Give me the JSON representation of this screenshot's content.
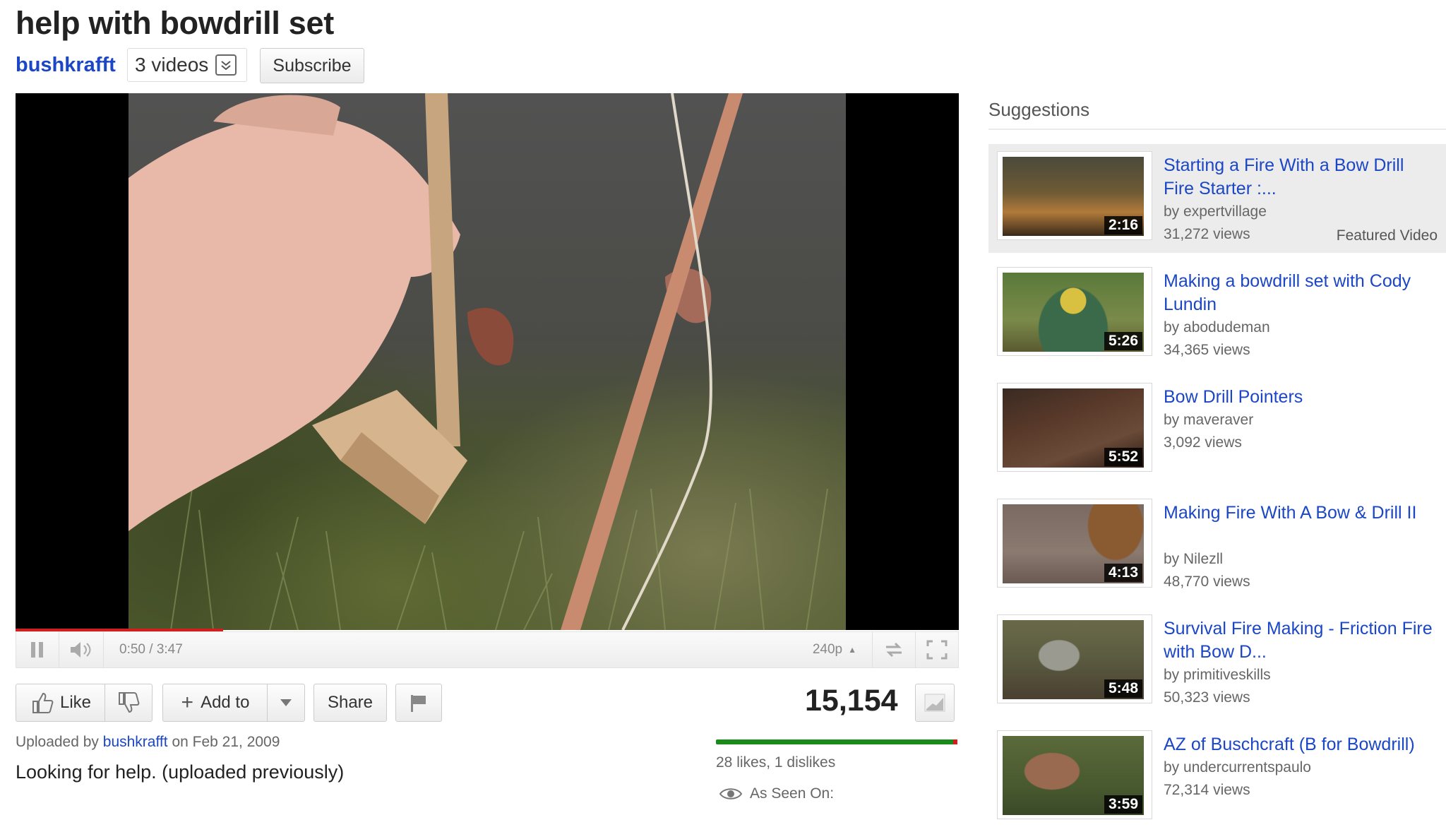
{
  "video": {
    "title": "help with bowdrill set",
    "channel": "bushkrafft",
    "videos_count": "3 videos",
    "subscribe_label": "Subscribe"
  },
  "player": {
    "time": "0:50 / 3:47",
    "quality": "240p",
    "progress_fraction": 0.22
  },
  "actions": {
    "like_label": "Like",
    "add_to_label": "Add to",
    "share_label": "Share",
    "view_count": "15,154"
  },
  "info": {
    "uploaded_prefix": "Uploaded by",
    "uploader": "bushkrafft",
    "date_text": "on Feb 21, 2009",
    "description": "Looking for help. (uploaded previously)",
    "likes_text": "28 likes, 1 dislikes",
    "as_seen_on": "As Seen On:",
    "likes": 28,
    "dislikes": 1
  },
  "sidebar": {
    "heading": "Suggestions",
    "items": [
      {
        "title": "Starting a Fire With a Bow Drill Fire Starter :...",
        "by": "by expertvillage",
        "views": "31,272 views",
        "duration": "2:16",
        "featured_label": "Featured Video"
      },
      {
        "title": "Making a bowdrill set with Cody Lundin",
        "by": "by abodudeman",
        "views": "34,365 views",
        "duration": "5:26"
      },
      {
        "title": "Bow Drill Pointers",
        "by": "by maveraver",
        "views": "3,092 views",
        "duration": "5:52"
      },
      {
        "title": "Making Fire With A Bow & Drill II",
        "by": "by Nilezll",
        "views": "48,770 views",
        "duration": "4:13"
      },
      {
        "title": "Survival Fire Making - Friction Fire with Bow D...",
        "by": "by primitiveskills",
        "views": "50,323 views",
        "duration": "5:48"
      },
      {
        "title": "AZ of Buschcraft (B for Bowdrill)",
        "by": "by undercurrentspaulo",
        "views": "72,314 views",
        "duration": "3:59"
      }
    ]
  },
  "colors": {
    "link": "#1b46c5",
    "progress": "#d01f1f",
    "like_bar": "#1a8a1a"
  }
}
